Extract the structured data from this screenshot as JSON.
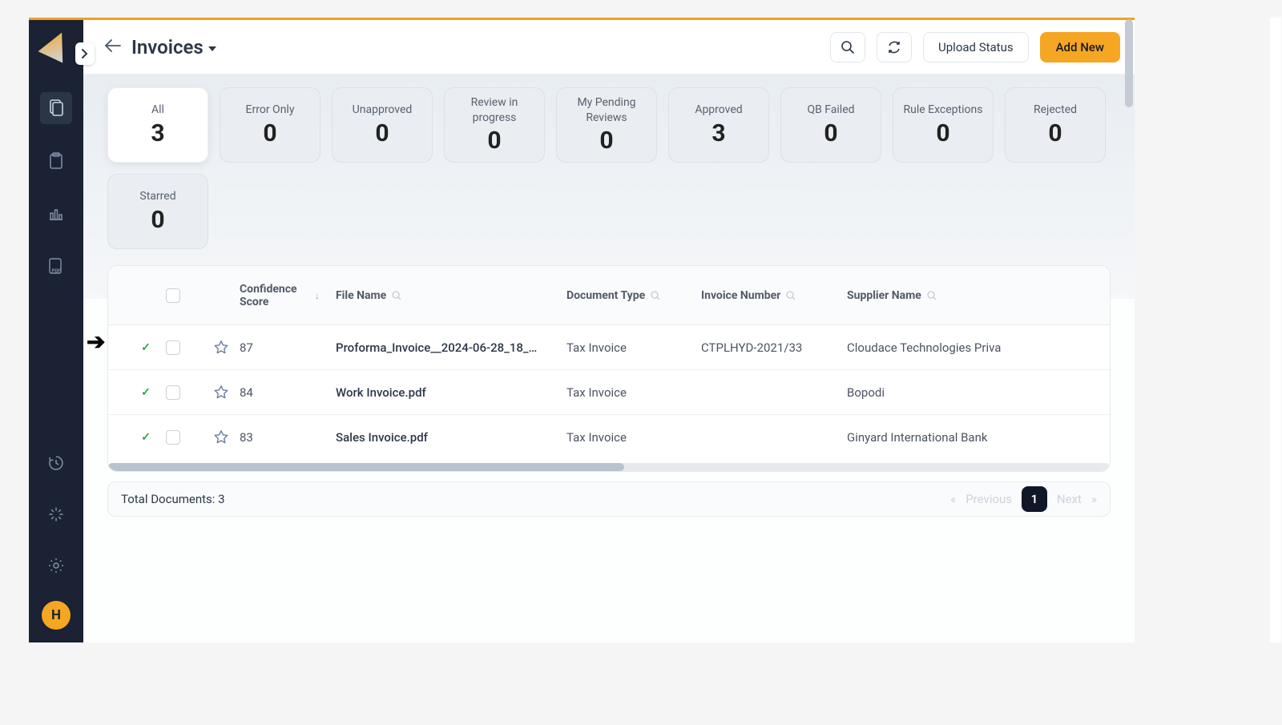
{
  "header": {
    "title": "Invoices",
    "upload_status_label": "Upload Status",
    "add_new_label": "Add New"
  },
  "avatar_initial": "H",
  "filters": [
    {
      "label": "All",
      "count": "3",
      "active": true
    },
    {
      "label": "Error Only",
      "count": "0",
      "active": false
    },
    {
      "label": "Unapproved",
      "count": "0",
      "active": false
    },
    {
      "label": "Review in progress",
      "count": "0",
      "active": false
    },
    {
      "label": "My Pending Reviews",
      "count": "0",
      "active": false
    },
    {
      "label": "Approved",
      "count": "3",
      "active": false
    },
    {
      "label": "QB Failed",
      "count": "0",
      "active": false
    },
    {
      "label": "Rule Exceptions",
      "count": "0",
      "active": false
    },
    {
      "label": "Rejected",
      "count": "0",
      "active": false
    },
    {
      "label": "Starred",
      "count": "0",
      "active": false
    }
  ],
  "columns": {
    "confidence": "Confidence Score",
    "file_name": "File Name",
    "document_type": "Document Type",
    "invoice_number": "Invoice Number",
    "supplier_name": "Supplier Name"
  },
  "rows": [
    {
      "confidence": "87",
      "file_name": "Proforma_Invoice__2024-06-28_18_…",
      "document_type": "Tax Invoice",
      "invoice_number": "CTPLHYD-2021/33",
      "supplier_name": "Cloudace Technologies Priva"
    },
    {
      "confidence": "84",
      "file_name": "Work Invoice.pdf",
      "document_type": "Tax Invoice",
      "invoice_number": "",
      "supplier_name": "Bopodi"
    },
    {
      "confidence": "83",
      "file_name": "Sales Invoice.pdf",
      "document_type": "Tax Invoice",
      "invoice_number": "",
      "supplier_name": "Ginyard International Bank"
    }
  ],
  "footer": {
    "total_label": "Total Documents: 3",
    "prev": "Previous",
    "next": "Next",
    "page": "1"
  }
}
